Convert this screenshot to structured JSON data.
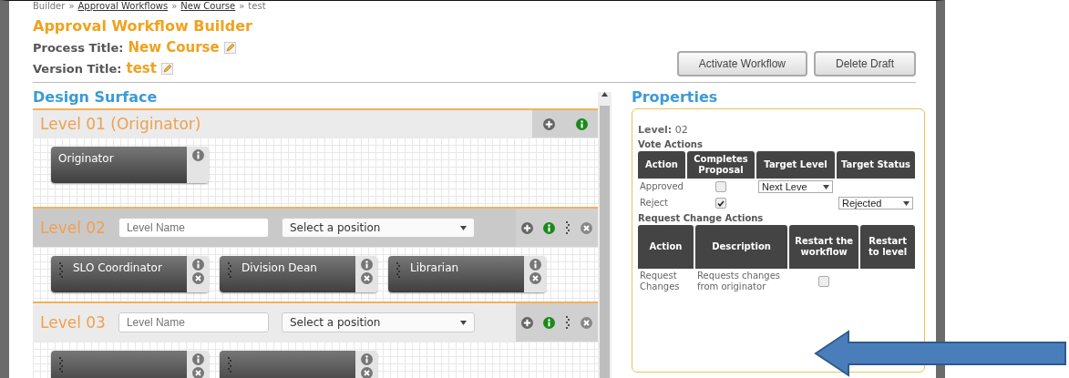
{
  "breadcrumb": [
    {
      "kind": "text",
      "label": "Builder"
    },
    {
      "kind": "separator",
      "label": "»"
    },
    {
      "kind": "link",
      "label": "Approval Workflows"
    },
    {
      "kind": "separator",
      "label": "»"
    },
    {
      "kind": "link",
      "label": "New Course"
    },
    {
      "kind": "separator",
      "label": "»"
    },
    {
      "kind": "text",
      "label": "test"
    }
  ],
  "page_title": "Approval Workflow Builder",
  "process_title": {
    "label": "Process Title:",
    "value": "New Course"
  },
  "version_title": {
    "label": "Version Title:",
    "value": "test"
  },
  "buttons": [
    "Activate Workflow",
    "Delete Draft"
  ],
  "design_surface": {
    "title": "Design Surface",
    "levels": [
      {
        "kind": "fixed",
        "title": "Level 01 (Originator)",
        "selected": false,
        "positions": [
          {
            "name": "Originator",
            "removable": false
          }
        ]
      },
      {
        "kind": "editable",
        "title": "Level 02",
        "selected": true,
        "name_placeholder": "Level Name",
        "position_select": "Select a position",
        "positions": [
          {
            "name": "SLO Coordinator",
            "removable": true
          },
          {
            "name": "Division Dean",
            "removable": true
          },
          {
            "name": "Librarian",
            "removable": true
          }
        ]
      },
      {
        "kind": "editable",
        "title": "Level 03",
        "selected": false,
        "name_placeholder": "Level Name",
        "position_select": "Select a position",
        "positions": [
          {
            "removable": true
          },
          {
            "removable": true
          }
        ]
      }
    ]
  },
  "properties": {
    "title": "Properties",
    "level_label": "Level:",
    "level_value": "02",
    "vote_actions": {
      "title": "Vote Actions",
      "columns": [
        "Action",
        "Completes Proposal",
        "Target Level",
        "Target Status"
      ],
      "rows": [
        {
          "action": "Approved",
          "completes": false,
          "target_level": "Next Leve"
        },
        {
          "action": "Reject",
          "completes": true,
          "target_status": "Rejected"
        }
      ]
    },
    "request_change_actions": {
      "title": "Request Change Actions",
      "columns": [
        "Action",
        "Description",
        "Restart the workflow",
        "Restart to level"
      ],
      "rows": [
        {
          "action": "Request Changes",
          "description": "Requests changes from originator",
          "restart": false
        }
      ]
    }
  }
}
